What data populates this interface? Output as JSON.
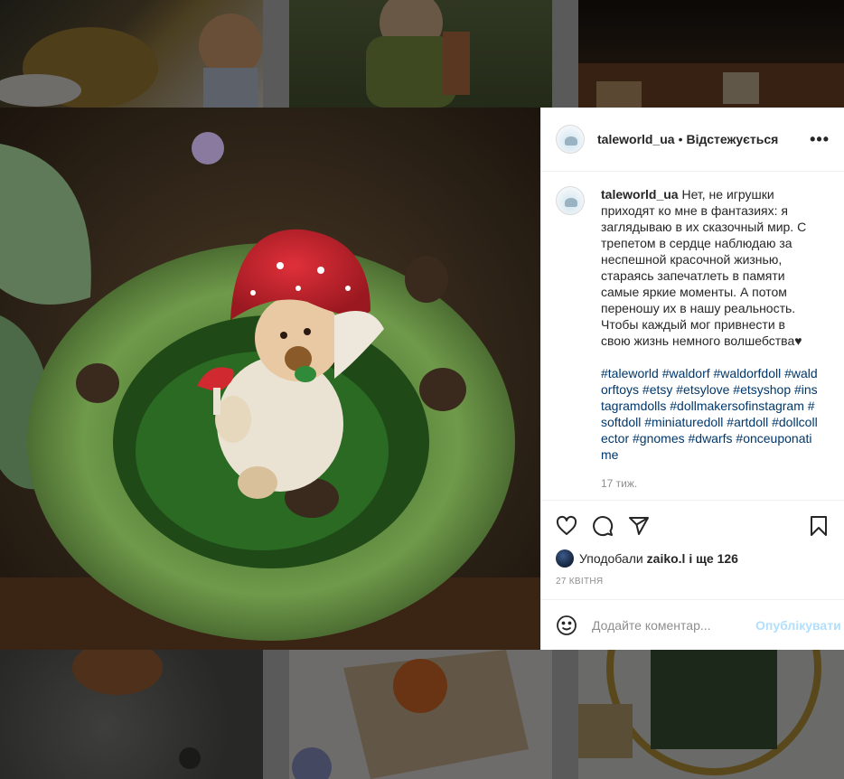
{
  "post": {
    "username": "taleworld_ua",
    "separator": "•",
    "follow_status": "Відстежується",
    "more": "•••",
    "caption_user": "taleworld_ua",
    "caption_text": "Нет, не игрушки приходят ко мне в фантазиях: я заглядываю в их сказочный мир. С трепетом в сердце наблюдаю за неспешной красочной жизнью, стараясь запечатлеть в памяти самые яркие моменты. А потом переношу их в нашу реальность. Чтобы каждый мог привнести в свою жизнь немного волшебства♥",
    "hashtags": "#taleworld #waldorf #waldorfdoll #waldorftoys #etsy #etsylove #etsyshop #instagramdolls #dollmakersofinstagram #softdoll #miniaturedoll #artdoll #dollcollector #gnomes #dwarfs #onceuponatime",
    "caption_age": "17 тиж.",
    "likes_prefix": "Уподобали",
    "likes_user": "zaiko.l",
    "likes_suffix": "і ще 126",
    "date": "27 квітня",
    "comment_placeholder": "Додайте коментар...",
    "post_button": "Опублікувати"
  },
  "icons": {
    "like": "heart-icon",
    "comment": "comment-icon",
    "share": "paper-plane-icon",
    "save": "bookmark-icon",
    "emoji": "smiley-icon",
    "more": "more-dots-icon"
  },
  "colors": {
    "text": "#262626",
    "secondary": "#8e8e8e",
    "hashtag": "#00376b",
    "post_button_disabled": "#b2dffc",
    "border": "#efefef"
  }
}
